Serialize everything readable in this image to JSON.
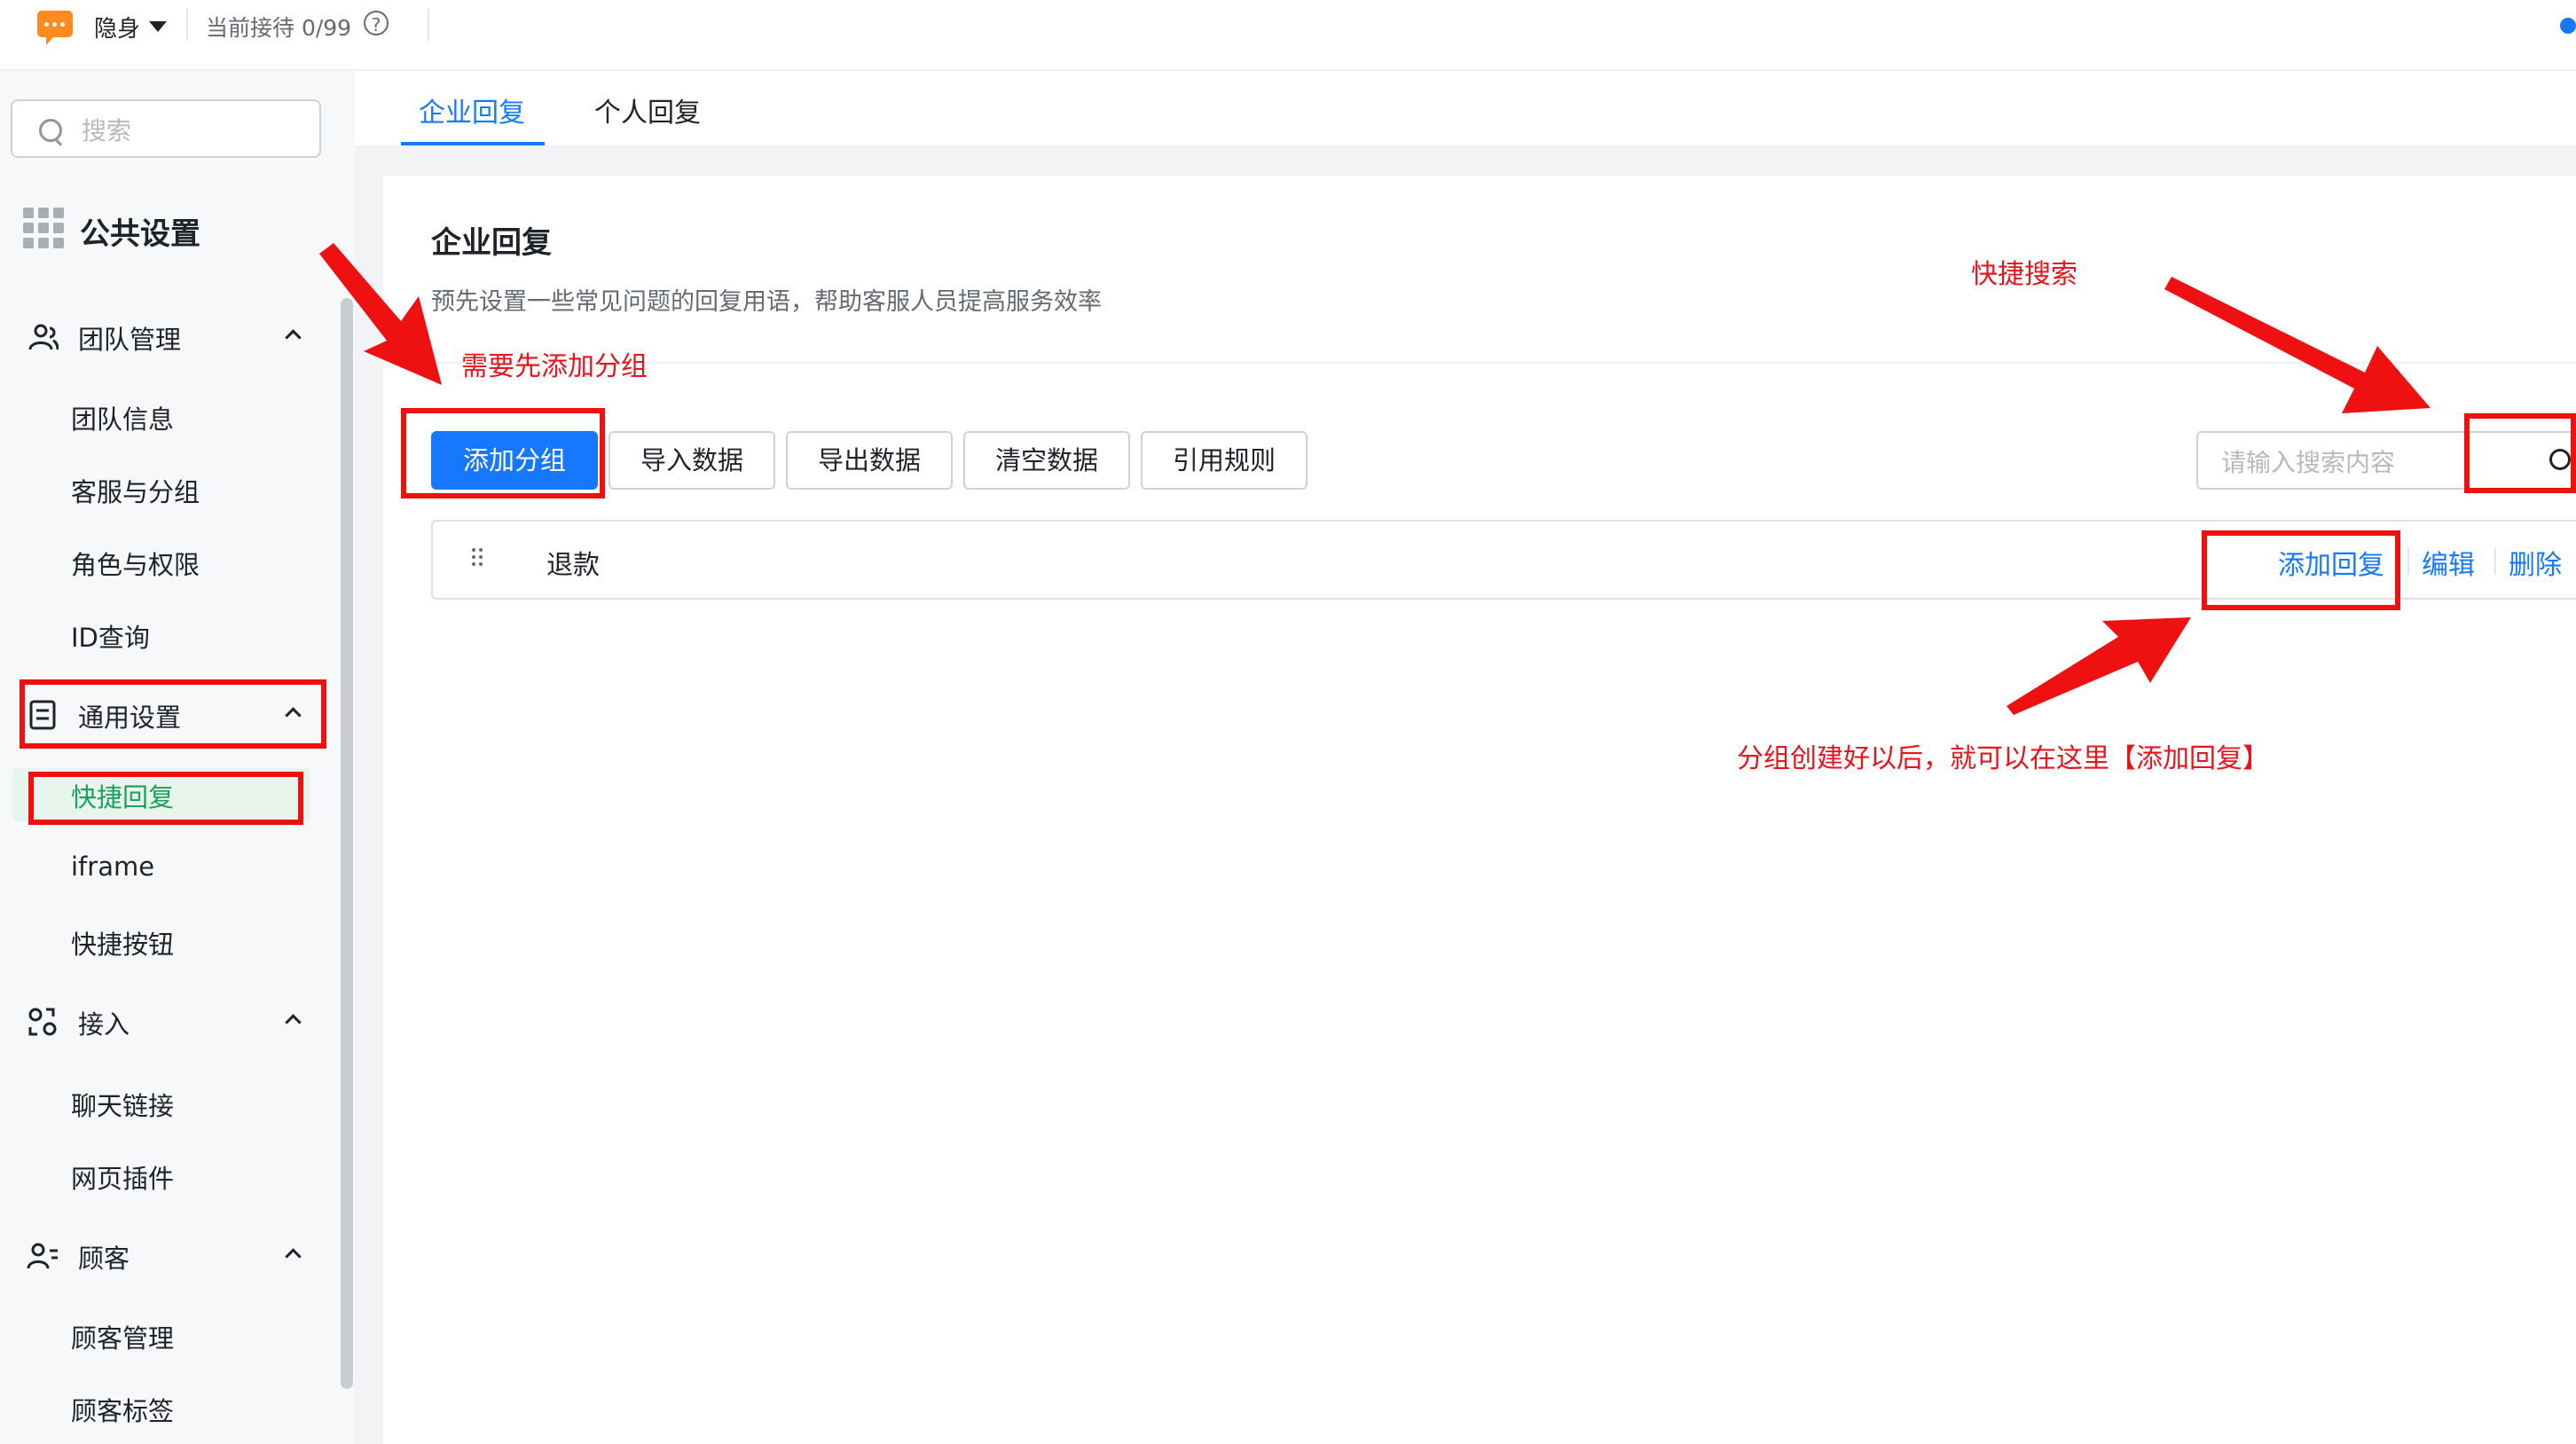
{
  "topbar": {
    "status": "隐身",
    "reception": "当前接待 0/99",
    "help_glyph": "?"
  },
  "sidebar": {
    "search_placeholder": "搜索",
    "section_title": "公共设置",
    "groups": [
      {
        "label": "团队管理",
        "icon": "team-icon",
        "items": [
          "团队信息",
          "客服与分组",
          "角色与权限",
          "ID查询"
        ]
      },
      {
        "label": "通用设置",
        "icon": "settings-doc-icon",
        "items": [
          "快捷回复",
          "iframe",
          "快捷按钮"
        ]
      },
      {
        "label": "接入",
        "icon": "access-icon",
        "items": [
          "聊天链接",
          "网页插件"
        ]
      },
      {
        "label": "顾客",
        "icon": "customer-icon",
        "items": [
          "顾客管理",
          "顾客标签"
        ]
      }
    ],
    "active_item": "快捷回复"
  },
  "tabs": [
    "企业回复",
    "个人回复"
  ],
  "card": {
    "title": "企业回复",
    "description": "预先设置一些常见问题的回复用语，帮助客服人员提高服务效率",
    "buttons": [
      "添加分组",
      "导入数据",
      "导出数据",
      "清空数据",
      "引用规则"
    ],
    "search_placeholder": "请输入搜索内容",
    "groups": [
      {
        "name": "退款",
        "actions": [
          "添加回复",
          "编辑",
          "删除"
        ]
      }
    ]
  },
  "annotations": {
    "add_group_note": "需要先添加分组",
    "quick_search_note": "快捷搜索",
    "add_reply_note": "分组创建好以后，就可以在这里【添加回复】"
  },
  "colors": {
    "primary": "#1677ff",
    "active_green": "#19a05a",
    "annotation_red": "#ef1111",
    "brand_orange": "#ff8a1f"
  }
}
